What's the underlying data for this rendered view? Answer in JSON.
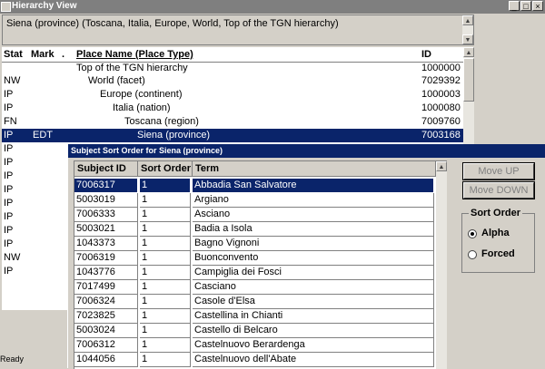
{
  "window": {
    "title": "Hierarchy View"
  },
  "breadcrumb": {
    "text": "Siena (province) (Toscana, Italia, Europe, World, Top of the TGN hierarchy)"
  },
  "list": {
    "headers": {
      "stat": "Stat",
      "mark": "Mark",
      "dot": ".",
      "name": "Place Name (Place Type)",
      "id": "ID"
    },
    "rows": [
      {
        "stat": "",
        "mark": "",
        "name": "Top of the TGN hierarchy",
        "id": "1000000"
      },
      {
        "stat": "NW",
        "mark": "",
        "name": "World (facet)",
        "id": "7029392"
      },
      {
        "stat": "IP",
        "mark": "",
        "name": "Europe (continent)",
        "id": "1000003"
      },
      {
        "stat": "IP",
        "mark": "",
        "name": "Italia (nation)",
        "id": "1000080"
      },
      {
        "stat": "FN",
        "mark": "",
        "name": "Toscana (region)",
        "id": "7009760"
      },
      {
        "stat": "IP",
        "mark": "EDT",
        "name": "Siena (province)",
        "id": "7003168"
      },
      {
        "stat": "IP",
        "mark": "",
        "name": "",
        "id": ""
      },
      {
        "stat": "IP",
        "mark": "",
        "name": "",
        "id": ""
      },
      {
        "stat": "IP",
        "mark": "",
        "name": "",
        "id": ""
      },
      {
        "stat": "IP",
        "mark": "",
        "name": "",
        "id": ""
      },
      {
        "stat": "IP",
        "mark": "",
        "name": "",
        "id": ""
      },
      {
        "stat": "IP",
        "mark": "",
        "name": "",
        "id": ""
      },
      {
        "stat": "IP",
        "mark": "",
        "name": "",
        "id": ""
      },
      {
        "stat": "IP",
        "mark": "",
        "name": "",
        "id": ""
      },
      {
        "stat": "NW",
        "mark": "",
        "name": "",
        "id": ""
      },
      {
        "stat": "IP",
        "mark": "",
        "name": "",
        "id": ""
      }
    ]
  },
  "statusbar": {
    "text": "Ready"
  },
  "dialog": {
    "title": "Subject Sort Order for Siena (province)",
    "grid": {
      "headers": {
        "subject_id": "Subject ID",
        "sort_order": "Sort Order",
        "term": "Term"
      },
      "rows": [
        {
          "subject_id": "7006317",
          "sort_order": "1",
          "term": "Abbadia San Salvatore"
        },
        {
          "subject_id": "5003019",
          "sort_order": "1",
          "term": "Argiano"
        },
        {
          "subject_id": "7006333",
          "sort_order": "1",
          "term": "Asciano"
        },
        {
          "subject_id": "5003021",
          "sort_order": "1",
          "term": "Badia a Isola"
        },
        {
          "subject_id": "1043373",
          "sort_order": "1",
          "term": "Bagno Vignoni"
        },
        {
          "subject_id": "7006319",
          "sort_order": "1",
          "term": "Buonconvento"
        },
        {
          "subject_id": "1043776",
          "sort_order": "1",
          "term": "Campiglia dei Fosci"
        },
        {
          "subject_id": "7017499",
          "sort_order": "1",
          "term": "Casciano"
        },
        {
          "subject_id": "7006324",
          "sort_order": "1",
          "term": "Casole d'Elsa"
        },
        {
          "subject_id": "7023825",
          "sort_order": "1",
          "term": "Castellina in Chianti"
        },
        {
          "subject_id": "5003024",
          "sort_order": "1",
          "term": "Castello di Belcaro"
        },
        {
          "subject_id": "7006312",
          "sort_order": "1",
          "term": "Castelnuovo Berardenga"
        },
        {
          "subject_id": "1044056",
          "sort_order": "1",
          "term": "Castelnuovo dell'Abate"
        }
      ]
    },
    "buttons": {
      "move_up": "Move UP",
      "move_down": "Move DOWN"
    },
    "sort_order": {
      "legend": "Sort Order",
      "alpha": "Alpha",
      "forced": "Forced",
      "selected": "alpha"
    }
  }
}
